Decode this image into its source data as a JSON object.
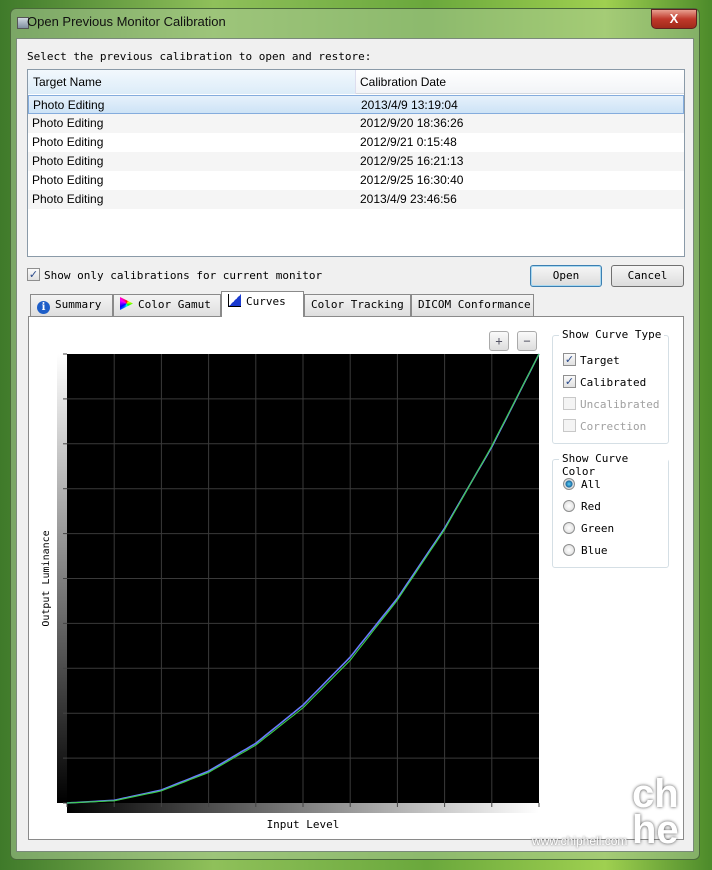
{
  "window": {
    "title": "Open Previous Monitor Calibration",
    "close_label": "X"
  },
  "prompt": "Select the previous calibration to open and restore:",
  "table": {
    "columns": [
      "Target Name",
      "Calibration Date"
    ],
    "rows": [
      [
        "Photo Editing",
        "2013/4/9 13:19:04"
      ],
      [
        "Photo Editing",
        "2012/9/20 18:36:26"
      ],
      [
        "Photo Editing",
        "2012/9/21 0:15:48"
      ],
      [
        "Photo Editing",
        "2012/9/25 16:21:13"
      ],
      [
        "Photo Editing",
        "2012/9/25 16:30:40"
      ],
      [
        "Photo Editing",
        "2013/4/9 23:46:56"
      ]
    ],
    "selected_index": 0
  },
  "filter": {
    "label": "Show only calibrations for current monitor",
    "checked": true
  },
  "buttons": {
    "open": "Open",
    "cancel": "Cancel"
  },
  "tabs": [
    {
      "label": "Summary",
      "icon": "info-icon"
    },
    {
      "label": "Color Gamut",
      "icon": "gamut-icon"
    },
    {
      "label": "Curves",
      "icon": "curve-icon",
      "active": true
    },
    {
      "label": "Color Tracking"
    },
    {
      "label": "DICOM Conformance"
    }
  ],
  "curve_type": {
    "title": "Show Curve Type",
    "options": [
      {
        "label": "Target",
        "checked": true,
        "enabled": true
      },
      {
        "label": "Calibrated",
        "checked": true,
        "enabled": true
      },
      {
        "label": "Uncalibrated",
        "checked": false,
        "enabled": false
      },
      {
        "label": "Correction",
        "checked": false,
        "enabled": false
      }
    ]
  },
  "curve_color": {
    "title": "Show Curve Color",
    "options": [
      "All",
      "Red",
      "Green",
      "Blue"
    ],
    "selected": "All"
  },
  "zoom": {
    "in": "+",
    "out": "−"
  },
  "chart_data": {
    "type": "line",
    "xlabel": "Input Level",
    "ylabel": "Output Luminance",
    "xlim": [
      0,
      1
    ],
    "ylim": [
      0,
      1
    ],
    "grid": true,
    "x": [
      0,
      0.1,
      0.2,
      0.3,
      0.4,
      0.5,
      0.6,
      0.7,
      0.8,
      0.9,
      1.0
    ],
    "series": [
      {
        "values": [
          0,
          0.006,
          0.029,
          0.071,
          0.133,
          0.218,
          0.325,
          0.456,
          0.612,
          0.793,
          1.0
        ],
        "color": "#6a7cff"
      },
      {
        "values": [
          0,
          0.005,
          0.027,
          0.068,
          0.129,
          0.212,
          0.318,
          0.452,
          0.609,
          0.795,
          1.0
        ],
        "color": "#3ccf4a"
      }
    ]
  },
  "watermark": {
    "logo": "chip hell",
    "url": "www.chiphell.com"
  }
}
